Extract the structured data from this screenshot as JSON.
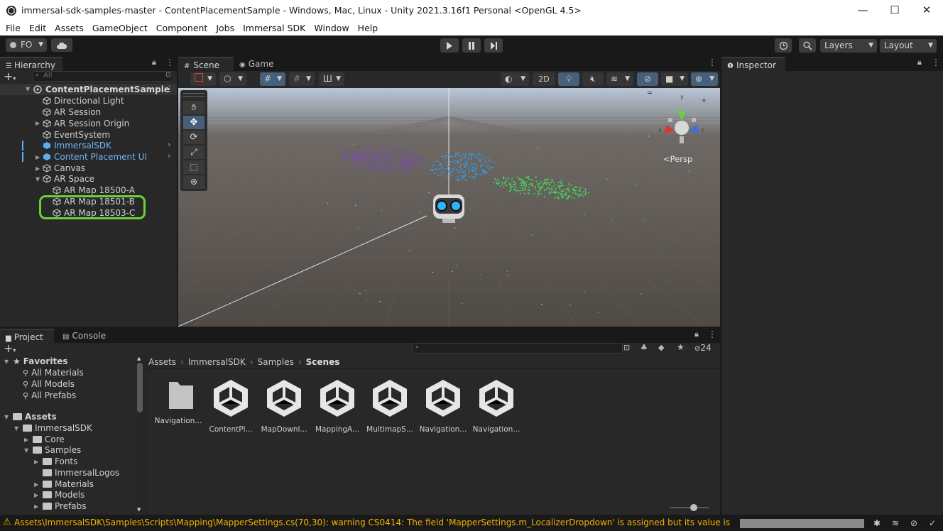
{
  "window": {
    "title": "immersal-sdk-samples-master - ContentPlacementSample - Windows, Mac, Linux - Unity 2021.3.16f1 Personal <OpenGL 4.5>",
    "controls": [
      "—",
      "☐",
      "✕"
    ]
  },
  "menu": [
    "File",
    "Edit",
    "Assets",
    "GameObject",
    "Component",
    "Jobs",
    "Immersal SDK",
    "Window",
    "Help"
  ],
  "toolbar": {
    "account": "FO",
    "layers": "Layers",
    "layout": "Layout"
  },
  "hierarchy": {
    "tab": "Hierarchy",
    "search_placeholder": "All",
    "scene": "ContentPlacementSample",
    "items": [
      {
        "label": "Directional Light"
      },
      {
        "label": "AR Session"
      },
      {
        "label": "AR Session Origin"
      },
      {
        "label": "EventSystem"
      },
      {
        "label": "ImmersalSDK"
      },
      {
        "label": "Content Placement UI"
      },
      {
        "label": "Canvas"
      },
      {
        "label": "AR Space"
      },
      {
        "label": "AR Map 18500-A"
      },
      {
        "label": "AR Map 18501-B"
      },
      {
        "label": "AR Map 18503-C"
      }
    ]
  },
  "scene_view": {
    "tabs": [
      "Scene",
      "Game"
    ],
    "toggle_2d": "2D",
    "persp_label": "Persp",
    "axes": {
      "x": "x",
      "y": "y",
      "z": "z"
    }
  },
  "inspector": {
    "tab": "Inspector"
  },
  "project": {
    "tabs": [
      "Project",
      "Console"
    ],
    "hidden_count": "24",
    "favorites_title": "Favorites",
    "favorites": [
      "All Materials",
      "All Models",
      "All Prefabs"
    ],
    "assets_title": "Assets",
    "tree": [
      "ImmersalSDK",
      "Core",
      "Samples",
      "Fonts",
      "ImmersalLogos",
      "Materials",
      "Models",
      "Prefabs"
    ],
    "breadcrumb": [
      "Assets",
      "ImmersalSDK",
      "Samples",
      "Scenes"
    ],
    "files": [
      "Navigation...",
      "ContentPl...",
      "MapDownl...",
      "MappingA...",
      "MultimapS...",
      "Navigation...",
      "Navigation..."
    ]
  },
  "status": {
    "message": "Assets\\ImmersalSDK\\Samples\\Scripts\\Mapping\\MapperSettings.cs(70,30): warning CS0414: The field 'MapperSettings.m_LocalizerDropdown' is assigned but its value is never us",
    "warning_color": "#f4b400"
  },
  "colors": {
    "highlight_green": "#6ad13a",
    "prefab_blue": "#5caef5",
    "purple_points": "#7b3fd6",
    "blue_points": "#2aa6ff",
    "green_points": "#3ee65a"
  }
}
